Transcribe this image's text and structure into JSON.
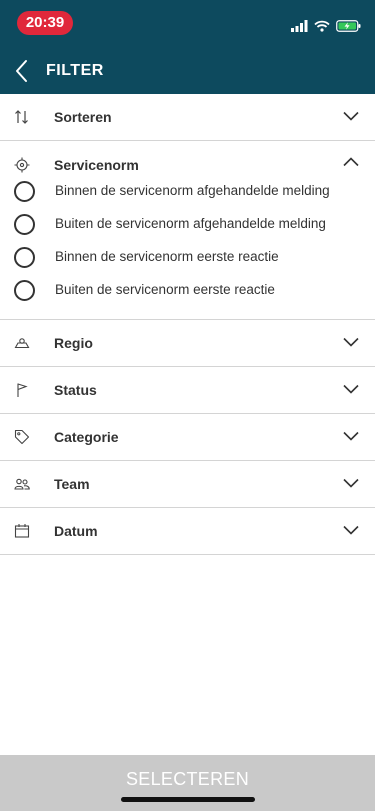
{
  "status_bar": {
    "time": "20:39"
  },
  "header": {
    "title": "FILTER"
  },
  "sorteren": {
    "label": "Sorteren"
  },
  "servicenorm": {
    "label": "Servicenorm",
    "options": [
      "Binnen de servicenorm afgehandelde melding",
      "Buiten de servicenorm afgehandelde melding",
      "Binnen de servicenorm eerste reactie",
      "Buiten de servicenorm eerste reactie"
    ]
  },
  "sections": [
    {
      "label": "Regio",
      "icon": "region-icon"
    },
    {
      "label": "Status",
      "icon": "flag-icon"
    },
    {
      "label": "Categorie",
      "icon": "tag-icon"
    },
    {
      "label": "Team",
      "icon": "team-icon"
    },
    {
      "label": "Datum",
      "icon": "calendar-icon"
    }
  ],
  "footer": {
    "select_label": "SELECTEREN"
  },
  "colors": {
    "header_bg": "#0d4a5e",
    "time_badge": "#e0283b",
    "footer_bg": "#c9c9c9"
  }
}
